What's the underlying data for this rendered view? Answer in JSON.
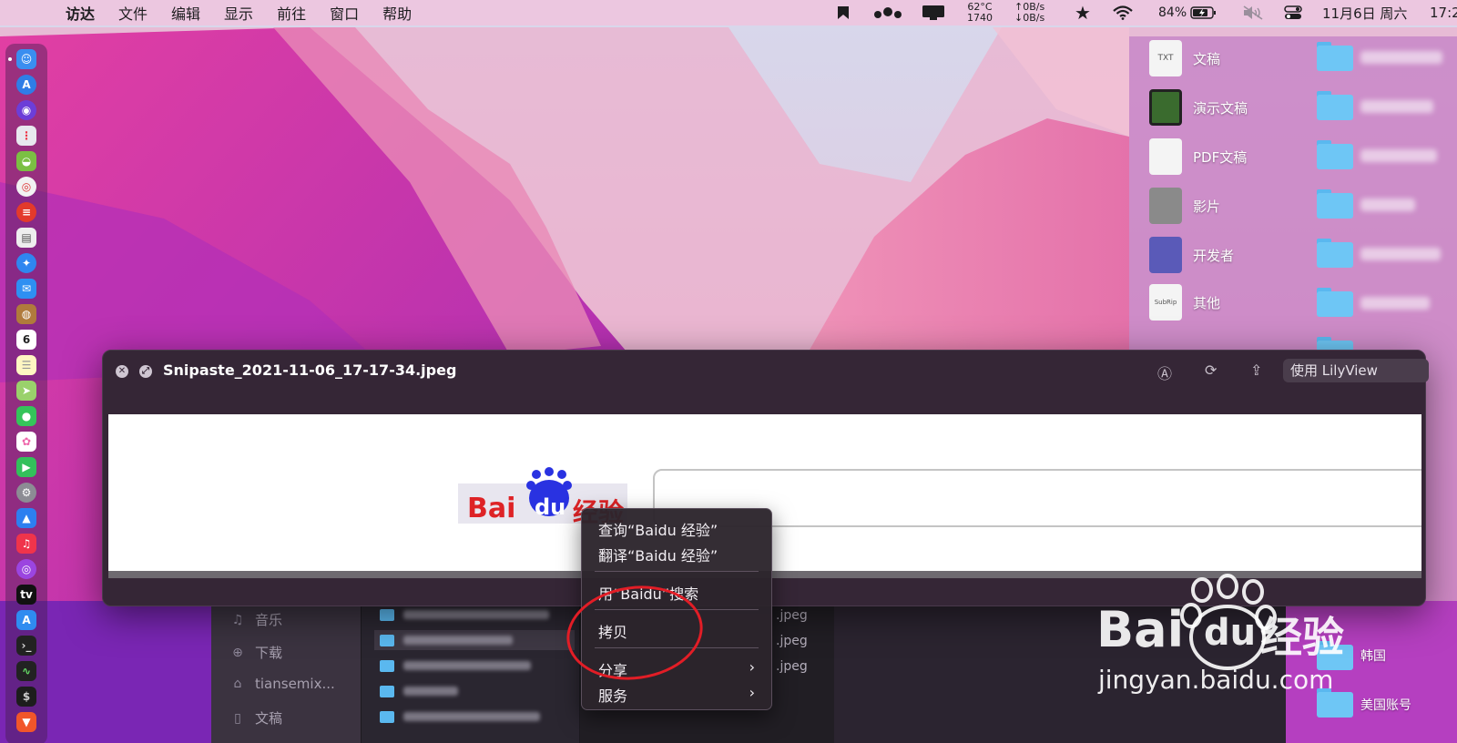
{
  "menubar": {
    "apple_glyph": "",
    "items": [
      "访达",
      "文件",
      "编辑",
      "显示",
      "前往",
      "窗口",
      "帮助"
    ],
    "temp": "62°C",
    "fan": "1740",
    "net_up": "↑0B/s",
    "net_down": "↓0B/s",
    "battery": "84%",
    "date": "11月6日 周六",
    "time": "17:2"
  },
  "desktop": {
    "stacks": [
      {
        "label": "文稿",
        "icon": "text-document-icon",
        "badge": "TXT"
      },
      {
        "label": "演示文稿",
        "icon": "presentation-icon",
        "badge": ""
      },
      {
        "label": "PDF文稿",
        "icon": "pdf-document-icon",
        "badge": ""
      },
      {
        "label": "影片",
        "icon": "movie-icon",
        "badge": ""
      },
      {
        "label": "开发者",
        "icon": "developer-icon",
        "badge": ""
      },
      {
        "label": "其他",
        "icon": "subrip-file-icon",
        "badge": "SubRip"
      }
    ],
    "folders_bottom": [
      {
        "label": "韩国"
      },
      {
        "label": "美国账号"
      }
    ]
  },
  "finder": {
    "sidebar": [
      {
        "icon": "music-icon",
        "glyph": "♫",
        "label": "音乐"
      },
      {
        "icon": "download-icon",
        "glyph": "⊕",
        "label": "下载"
      },
      {
        "icon": "home-icon",
        "glyph": "⌂",
        "label": "tiansemix..."
      },
      {
        "icon": "document-icon",
        "glyph": "▯",
        "label": "文稿"
      }
    ],
    "jpeg_labels": [
      ".jpeg",
      ".jpeg",
      ".jpeg"
    ]
  },
  "quicklook": {
    "filename": "Snipaste_2021-11-06_17-17-34.jpeg",
    "close_glyph": "✕",
    "fullscreen_glyph": "⤢",
    "open_with": "使用 LilyView",
    "tools": {
      "markup": "Ⓐ",
      "rotate": "⟳",
      "share": "⇪"
    }
  },
  "context_menu": {
    "items": [
      {
        "label": "查询“Baidu 经验”",
        "submenu": false
      },
      {
        "label": "翻译“Baidu 经验”",
        "submenu": false
      },
      {
        "label": "用“Baidu”搜索",
        "submenu": false
      },
      {
        "label": "拷贝",
        "submenu": false
      },
      {
        "label": "分享",
        "submenu": true
      },
      {
        "label": "服务",
        "submenu": true
      }
    ],
    "arrow": "›"
  },
  "logo": {
    "bai": "Bai",
    "du": "du",
    "jingyan": "经验"
  },
  "watermark": {
    "bai": "Bai",
    "du": "du",
    "jingyan": "经验",
    "url": "jingyan.baidu.com"
  },
  "colors": {
    "accent_red": "#e21d26",
    "baidu_blue": "#2932e1",
    "folder_blue": "#6ec6f5"
  }
}
